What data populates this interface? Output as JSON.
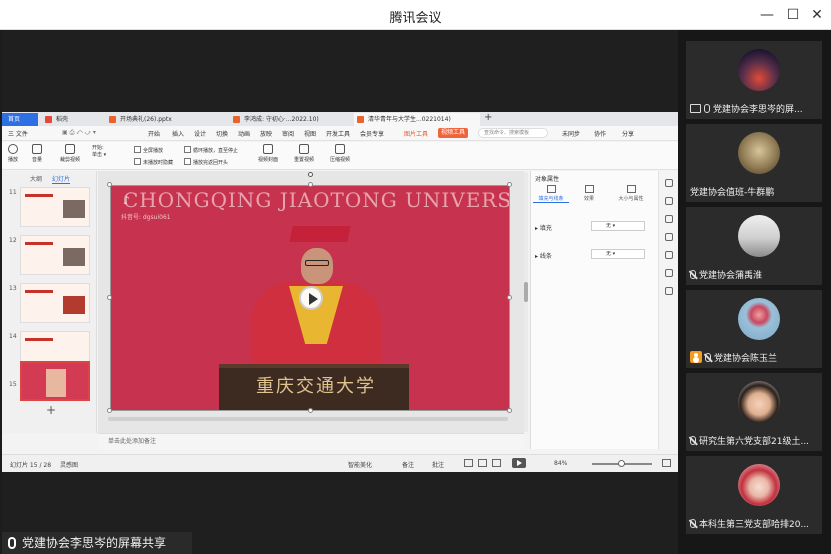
{
  "window": {
    "title": "腾讯会议"
  },
  "share": {
    "sharer_label": "党建协会李思岑的屏幕共享"
  },
  "wps": {
    "tabs": [
      {
        "label": "首页"
      },
      {
        "label": "稻壳"
      },
      {
        "label": "开场典礼(26).pptx"
      },
      {
        "label": "李鸿成: 守初心·...2022.10)"
      },
      {
        "label": "清华青年与大学生...0221014)"
      }
    ],
    "menu": {
      "file": "三 文件",
      "items": [
        "开始",
        "插入",
        "设计",
        "切换",
        "动画",
        "放映",
        "审阅",
        "视图",
        "开发工具",
        "会员专享"
      ],
      "picture_tools": "图片工具",
      "video_tools": "视频工具",
      "search_placeholder": "查找命令、搜索模板",
      "right_items": [
        "未同步",
        "协作",
        "分享"
      ]
    },
    "toolbar": {
      "play": "播放",
      "volume": "音量",
      "crop_video": "裁剪视频",
      "start": "开始:",
      "on_click": "单击",
      "checks": [
        "全屏播放",
        "未播放时隐藏",
        "循环播放，直至停止",
        "播放完返回开头"
      ],
      "video_cover": "视频封面",
      "reset_video": "重置视频",
      "compress_video": "压缩视频"
    },
    "slide_panel": {
      "tab_outline": "大纲",
      "tab_slides": "幻灯片",
      "numbers": [
        "11",
        "12",
        "13",
        "14",
        "15"
      ],
      "add": "+"
    },
    "slide": {
      "university_name": "CHONGQING JIAOTONG UNIVERSITY",
      "douyin_id": "抖音号: dgsui061",
      "podium_text": "重庆交通大学"
    },
    "notes_placeholder": "单击此处添加备注",
    "props": {
      "title": "对象属性",
      "tabs": [
        "填充与线条",
        "效果",
        "大小与属性"
      ],
      "fill_label": "填充",
      "fill_value": "无",
      "line_label": "线条",
      "line_value": "无"
    },
    "status": {
      "slide_count": "幻灯片 15 / 28",
      "theme": "灵感图",
      "smart_beautify": "智能美化",
      "notes": "备注",
      "comments": "批注",
      "zoom": "84%"
    }
  },
  "participants": [
    {
      "name": "党建协会李思岑的屏...",
      "status": "sharing"
    },
    {
      "name": "党建协会值班-牛群鹏",
      "status": "none"
    },
    {
      "name": "党建协会蒲禹淮",
      "status": "muted"
    },
    {
      "name": "党建协会陈玉兰",
      "status": "muted"
    },
    {
      "name": "研究生第六党支部21级土...",
      "status": "muted"
    },
    {
      "name": "本科生第三党支部哈排20...",
      "status": "muted"
    }
  ]
}
